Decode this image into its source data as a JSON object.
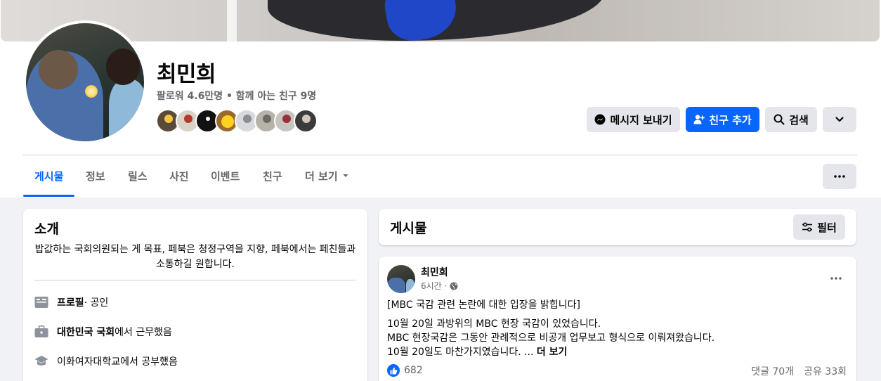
{
  "profile": {
    "name": "최민희",
    "meta": "팔로워 4.6만명 • 함께 아는 친구 9명"
  },
  "actions": {
    "message": "메시지 보내기",
    "add_friend": "친구 추가",
    "search": "검색"
  },
  "tabs": [
    {
      "label": "게시물"
    },
    {
      "label": "정보"
    },
    {
      "label": "릴스"
    },
    {
      "label": "사진"
    },
    {
      "label": "이벤트"
    },
    {
      "label": "친구"
    },
    {
      "label": "더 보기"
    }
  ],
  "intro": {
    "title": "소개",
    "bio": "밥값하는 국회의원되는 게 목표, 페북은 청정구역을 지향, 페북에서는 페친들과 소통하길 원합니다.",
    "rows": [
      {
        "bold": "프로필",
        "text": " · 공인"
      },
      {
        "bold": "대한민국 국회",
        "text": "에서 근무했음"
      },
      {
        "bold": "",
        "text": "이화여자대학교에서 공부했음"
      }
    ]
  },
  "posts_section": {
    "title": "게시물",
    "filter": "필터"
  },
  "post": {
    "author": "최민희",
    "time": "6시간 ·",
    "headline": "[MBC 국감 관련 논란에 대한 입장을 밝힙니다]",
    "line1": "10월 20일 과방위의 MBC 현장 국감이 있었습니다.",
    "line2": "MBC 현장국감은 그동안 관례적으로 비공개 업무보고 형식으로 이뤄져왔습니다.",
    "line3": "10월 20일도 마찬가지였습니다. ...",
    "see_more": "더 보기",
    "likes": "682",
    "comments": "댓글 70개",
    "shares": "공유 33회"
  },
  "colors": {
    "accent": "#0866ff",
    "button_gray": "#e4e6eb",
    "secondary_text": "#65676b",
    "page_bg": "#f0f2f5"
  },
  "friend_avatar_colors": [
    "#3a2e24",
    "#b23a2a",
    "#121212",
    "#d9a400",
    "#bfc2c6",
    "#6d6a64",
    "#9a2f3e",
    "#3b3b3b"
  ]
}
